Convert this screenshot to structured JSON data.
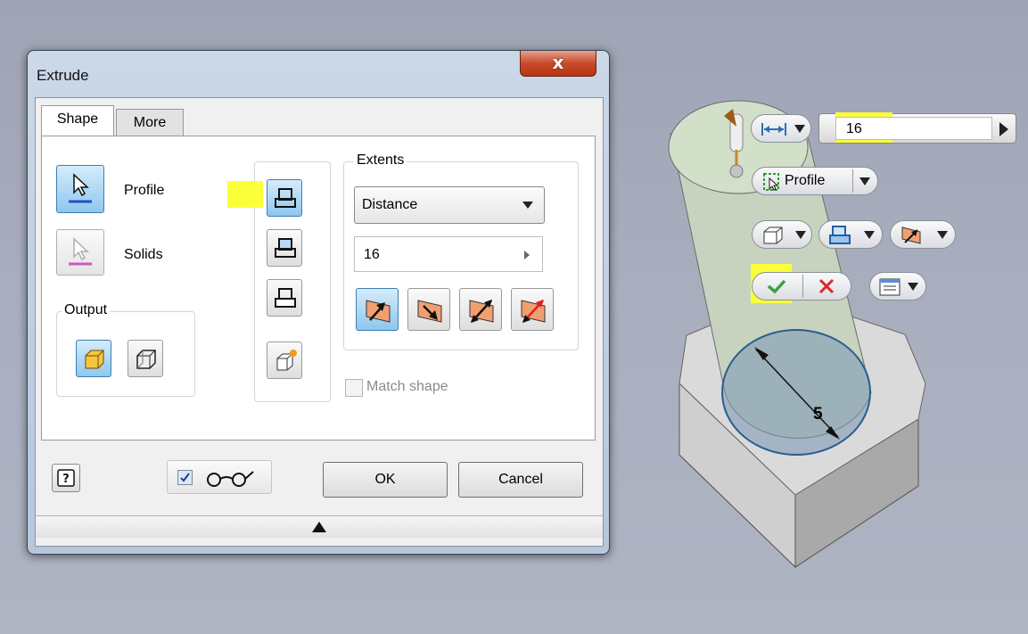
{
  "dialog": {
    "title": "Extrude",
    "close_glyph": "x",
    "tabs": [
      {
        "label": "Shape",
        "active": true
      },
      {
        "label": "More",
        "active": false
      }
    ],
    "profile_label": "Profile",
    "solids_label": "Solids",
    "output_label": "Output",
    "extents_label": "Extents",
    "extents_type": "Distance",
    "distance_value": "16",
    "match_shape_label": "Match shape",
    "match_shape_checked": false,
    "preview_checked": true,
    "ok_label": "OK",
    "cancel_label": "Cancel",
    "icons": {
      "profile": "cursor-select-icon",
      "solids": "cursor-select-solids-icon",
      "output_solid": "solid-cube-icon",
      "output_surface": "surface-cube-icon",
      "operation_join": "join-icon",
      "operation_cut": "cut-icon",
      "operation_intersect": "intersect-icon",
      "new_solid": "new-solid-icon",
      "dir_default": "direction-default-icon",
      "dir_flipped": "direction-flipped-icon",
      "dir_symmetric": "direction-symmetric-icon",
      "dir_asymmetric": "direction-asymmetric-icon",
      "help": "help-icon",
      "preview": "glasses-icon",
      "expand": "expand-arrow-icon"
    }
  },
  "mini_toolbar": {
    "distance_value": "16",
    "profile_label": "Profile"
  },
  "model": {
    "dimension_value": "5"
  },
  "colors": {
    "highlight": "#fbff3a",
    "accent_blue": "#3d7fb3",
    "ok_green": "#3aa33a",
    "cancel_red": "#d8282a",
    "model_face": "#d6d6d6",
    "cylinder": "#c6d2bc",
    "profile_blue": "#6e8cab"
  }
}
